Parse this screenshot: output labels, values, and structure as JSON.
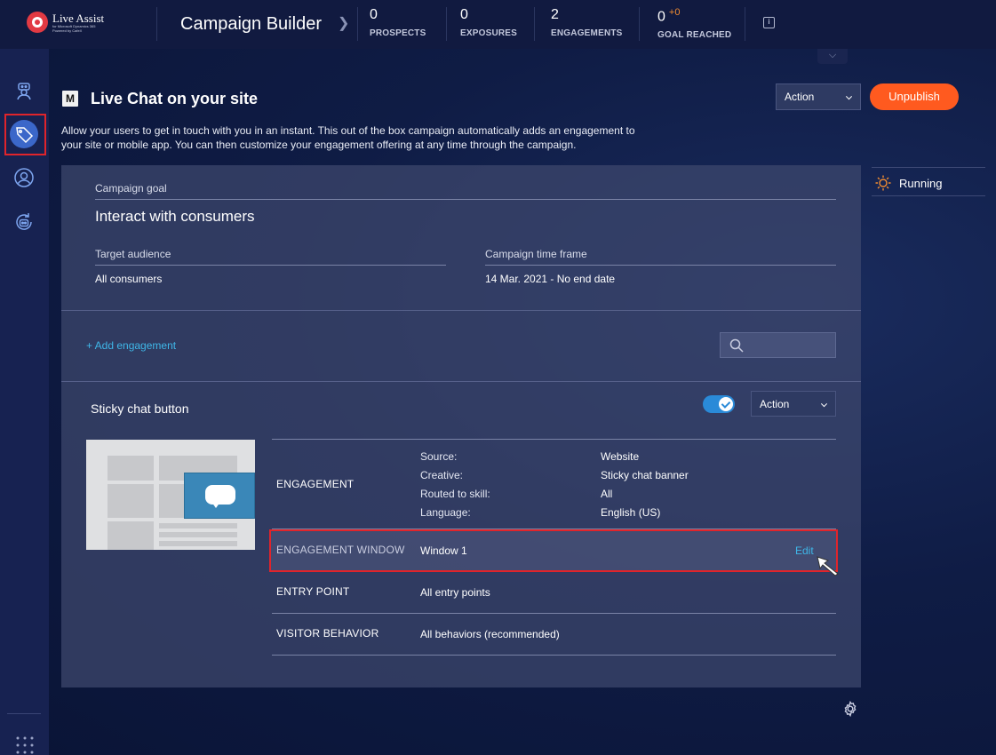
{
  "topbar": {
    "logo_title": "Live Assist",
    "logo_sub_1": "for Microsoft Dynamics 365",
    "logo_sub_2": "Powered by CafeX",
    "app_title": "Campaign Builder",
    "stats": [
      {
        "value": "0",
        "label": "PROSPECTS"
      },
      {
        "value": "0",
        "label": "EXPOSURES"
      },
      {
        "value": "2",
        "label": "ENGAGEMENTS"
      },
      {
        "value": "0",
        "extra": "+0",
        "label": "GOAL REACHED"
      }
    ]
  },
  "leftnav": {
    "items": [
      "chatbot-icon",
      "campaign-tag-icon",
      "user-icon",
      "bot-refresh-icon"
    ],
    "active_item": "campaign-tag-icon"
  },
  "page": {
    "badge": "M",
    "title": "Live Chat on your site",
    "description": "Allow your users to get in touch with you in an instant. This out of the box campaign automatically adds an engagement to your site or mobile app. You can then customize your engagement offering at any time through the campaign.",
    "action_label": "Action",
    "unpublish_label": "Unpublish",
    "status": "Running"
  },
  "campaign": {
    "goal_label": "Campaign goal",
    "goal_value": "Interact with consumers",
    "audience_label": "Target audience",
    "audience_value": "All consumers",
    "timeframe_label": "Campaign time frame",
    "timeframe_value": "14 Mar. 2021 - No end date",
    "add_engagement": "+  Add engagement",
    "search_placeholder": ""
  },
  "engagement": {
    "title": "Sticky chat button",
    "enabled": true,
    "action_label": "Action",
    "rows": {
      "engagement": {
        "key": "ENGAGEMENT",
        "details": [
          {
            "label": "Source:",
            "value": "Website"
          },
          {
            "label": "Creative:",
            "value": "Sticky chat banner"
          },
          {
            "label": "Routed to skill:",
            "value": "All"
          },
          {
            "label": "Language:",
            "value": "English (US)"
          }
        ]
      },
      "window": {
        "key": "ENGAGEMENT WINDOW",
        "value": "Window 1",
        "edit_label": "Edit"
      },
      "entry_point": {
        "key": "ENTRY POINT",
        "value": "All entry points"
      },
      "visitor_behavior": {
        "key": "VISITOR BEHAVIOR",
        "value": "All behaviors (recommended)"
      }
    }
  },
  "colors": {
    "accent_orange": "#ff5a1f",
    "link_blue": "#3fb7e8",
    "highlight_red": "#e0242b",
    "toggle_blue": "#2a8ad8"
  }
}
